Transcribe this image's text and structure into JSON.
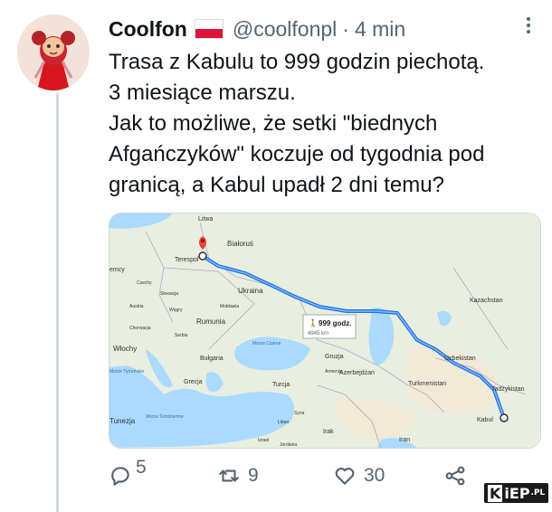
{
  "tweet": {
    "display_name": "Coolfon",
    "handle": "@coolfonpl",
    "separator": "·",
    "time": "4 min",
    "text_lines": [
      "Trasa z Kabulu to 999 godzin piechotą.",
      "3 miesiące marszu.",
      "Jak to możliwe, że setki \"biednych",
      "Afgańczyków\" koczuje od tygodnia pod",
      "granicą, a Kabul upadł 2 dni temu?"
    ]
  },
  "map": {
    "route_label": "999 godz.",
    "route_distance": "4945 km",
    "places": [
      {
        "name": "Litwa"
      },
      {
        "name": "Białoruś"
      },
      {
        "name": "Terespol"
      },
      {
        "name": "emcy"
      },
      {
        "name": "Czechy"
      },
      {
        "name": "Słowacja"
      },
      {
        "name": "Ukraina"
      },
      {
        "name": "Austria"
      },
      {
        "name": "Węgry"
      },
      {
        "name": "Mołdawia"
      },
      {
        "name": "Chorwacja"
      },
      {
        "name": "Serbia"
      },
      {
        "name": "Rumunia"
      },
      {
        "name": "Włochy"
      },
      {
        "name": "Bułgaria"
      },
      {
        "name": "Morze Czarne"
      },
      {
        "name": "Gruzja"
      },
      {
        "name": "Grecja"
      },
      {
        "name": "Turcja"
      },
      {
        "name": "Azerbejdżan"
      },
      {
        "name": "Kazachstan"
      },
      {
        "name": "Uzbekistan"
      },
      {
        "name": "Turkmenistan"
      },
      {
        "name": "Tadżykistan"
      },
      {
        "name": "Kabul"
      },
      {
        "name": "Morze Śródziemne"
      },
      {
        "name": "Syria"
      },
      {
        "name": "Irak"
      },
      {
        "name": "Iran"
      },
      {
        "name": "Liban"
      },
      {
        "name": "Izrael"
      },
      {
        "name": "Jordania"
      },
      {
        "name": "Armenia"
      },
      {
        "name": "Tunezja"
      },
      {
        "name": "Morze Tyrreńskie"
      }
    ]
  },
  "actions": {
    "replies": "5",
    "retweets": "9",
    "likes": "30"
  },
  "watermark": {
    "k": "K",
    "main": "iEP",
    "suffix": ".PL"
  },
  "colors": {
    "route": "#4285f4",
    "pin": "#ea4335",
    "water": "#aadaff",
    "land": "#eaf0e2"
  }
}
